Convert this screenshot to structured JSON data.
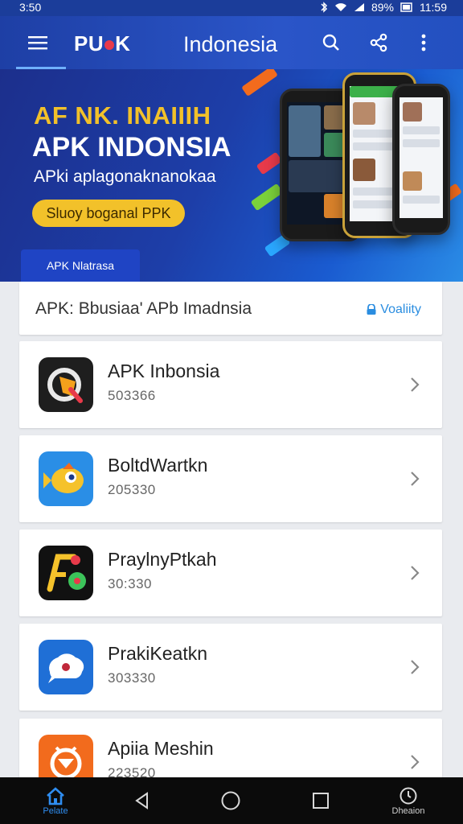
{
  "status_bar": {
    "time_left": "3:50",
    "battery": "89%",
    "time_right": "11:59"
  },
  "app_bar": {
    "logo_left": "PU",
    "logo_right": "K",
    "title": "Indonesia",
    "icons": [
      "menu-icon",
      "search-icon",
      "share-icon",
      "more-vert-icon"
    ]
  },
  "banner": {
    "kicker": "AF NK. INAIIIH",
    "headline": "APK INDONSIA",
    "subtitle": "APki aplagonaknanokaa",
    "cta": "Sluoy boganal PPK",
    "tag": "APK Nlatrasa"
  },
  "search_section": {
    "label": "APK: Bbusiaa' APb Imadnsia",
    "link": "Voaliity"
  },
  "apps": [
    {
      "name": "APK Inbonsia",
      "meta": "503366",
      "icon": "apk-q-icon",
      "colors": [
        "#1e1e1e",
        "#f4a11c"
      ]
    },
    {
      "name": "BoltdWartkn",
      "meta": "205330",
      "icon": "fish-icon",
      "colors": [
        "#2a8ee6",
        "#f5c22b"
      ]
    },
    {
      "name": "PraylnyPtkah",
      "meta": "30:330",
      "icon": "pf-icon",
      "colors": [
        "#111111",
        "#3cc35a"
      ]
    },
    {
      "name": "PrakiKeatkn",
      "meta": "303330",
      "icon": "chat-bubble-icon",
      "colors": [
        "#1f6fd6",
        "#ffffff"
      ]
    },
    {
      "name": "Apiia Meshin",
      "meta": "223520",
      "icon": "robot-icon",
      "colors": [
        "#f26b1d",
        "#ffffff"
      ]
    }
  ],
  "nav": {
    "home_label": "Pelate",
    "right_label": "Dheaion",
    "accent": "#2f8df0"
  }
}
